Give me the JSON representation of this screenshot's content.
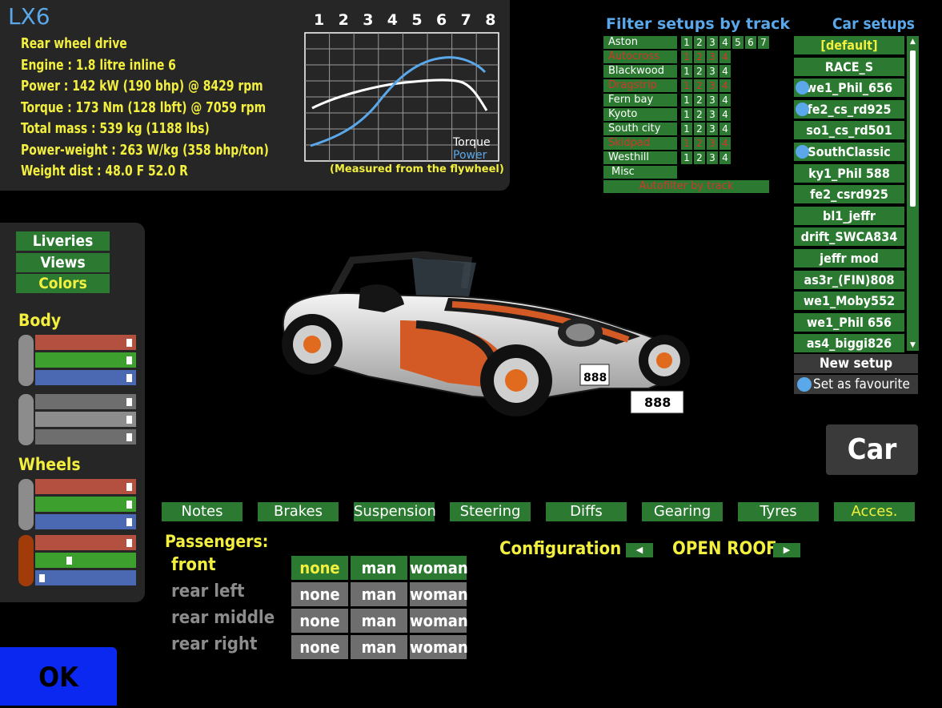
{
  "car": {
    "name": "LX6",
    "specs": [
      "Rear wheel drive",
      "Engine : 1.8 litre inline 6",
      "Power : 142 kW (190 bhp) @ 8429 rpm",
      "Torque : 173 Nm (128 lbft) @ 7059 rpm",
      "Total mass : 539 kg (1188 lbs)",
      "Power-weight : 263 W/kg (358 bhp/ton)",
      "Weight dist : 48.0 F  52.0 R"
    ]
  },
  "graph": {
    "rpm_ticks": [
      "1",
      "2",
      "3",
      "4",
      "5",
      "6",
      "7",
      "8"
    ],
    "legend_torque": "Torque",
    "legend_power": "Power",
    "note": "(Measured from the flywheel)",
    "torque_color": "#ffffff",
    "power_color": "#5aa8ea"
  },
  "filter": {
    "title": "Filter setups by track",
    "tracks": [
      {
        "name": "Aston",
        "nums": [
          "1",
          "2",
          "3",
          "4",
          "5",
          "6",
          "7"
        ],
        "red": false
      },
      {
        "name": "Autocross",
        "nums": [
          "1",
          "2",
          "3",
          "4"
        ],
        "red": true
      },
      {
        "name": "Blackwood",
        "nums": [
          "1",
          "2",
          "3",
          "4"
        ],
        "red": false
      },
      {
        "name": "Dragstrip",
        "nums": [
          "1",
          "2",
          "3",
          "4"
        ],
        "red": true
      },
      {
        "name": "Fern bay",
        "nums": [
          "1",
          "2",
          "3",
          "4"
        ],
        "red": false
      },
      {
        "name": "Kyoto",
        "nums": [
          "1",
          "2",
          "3",
          "4"
        ],
        "red": false
      },
      {
        "name": "South city",
        "nums": [
          "1",
          "2",
          "3",
          "4"
        ],
        "red": false
      },
      {
        "name": "Skidpad",
        "nums": [
          "1",
          "2",
          "3",
          "4"
        ],
        "red": true
      },
      {
        "name": "Westhill",
        "nums": [
          "1",
          "2",
          "3",
          "4"
        ],
        "red": false
      }
    ],
    "misc": "Misc",
    "autofilter": "Autofilter by track"
  },
  "setups": {
    "title": "Car setups",
    "items": [
      {
        "label": "[default]",
        "dot": false,
        "default": true
      },
      {
        "label": "RACE_S",
        "dot": false,
        "default": false
      },
      {
        "label": "we1_Phil_656",
        "dot": true,
        "default": false
      },
      {
        "label": "fe2_cs_rd925",
        "dot": true,
        "default": false
      },
      {
        "label": "so1_cs_rd501",
        "dot": false,
        "default": false
      },
      {
        "label": "SouthClassic",
        "dot": true,
        "default": false
      },
      {
        "label": "ky1_Phil 588",
        "dot": false,
        "default": false
      },
      {
        "label": "fe2_csrd925",
        "dot": false,
        "default": false
      },
      {
        "label": "bl1_jeffr",
        "dot": false,
        "default": false
      },
      {
        "label": "drift_SWCA834",
        "dot": false,
        "default": false
      },
      {
        "label": "jeffr mod",
        "dot": false,
        "default": false
      },
      {
        "label": "as3r_(FIN)808",
        "dot": false,
        "default": false
      },
      {
        "label": "we1_Moby552",
        "dot": false,
        "default": false
      },
      {
        "label": "we1_Phil 656",
        "dot": false,
        "default": false
      },
      {
        "label": "as4_biggi826",
        "dot": false,
        "default": false
      }
    ],
    "new_setup": "New setup",
    "set_favourite": "Set as favourite",
    "car_button": "Car"
  },
  "left_panel": {
    "buttons": [
      "Liveries",
      "Views",
      "Colors"
    ],
    "active_button": "Colors",
    "body_label": "Body",
    "wheels_label": "Wheels",
    "body_group1": {
      "swatch": "#8c8c8c",
      "sliders": [
        {
          "color": "#b3503f",
          "level": 0.96
        },
        {
          "color": "#3da02e",
          "level": 0.96
        },
        {
          "color": "#4b68b2",
          "level": 0.96
        }
      ]
    },
    "body_group2": {
      "swatch": "#8c8c8c",
      "sliders": [
        {
          "color": "#6e6e6e",
          "level": 0.96
        },
        {
          "color": "#8c8c8c",
          "level": 0.96
        },
        {
          "color": "#6e6e6e",
          "level": 0.96
        }
      ]
    },
    "wheels_group1": {
      "swatch": "#8c8c8c",
      "sliders": [
        {
          "color": "#b3503f",
          "level": 0.96
        },
        {
          "color": "#3da02e",
          "level": 0.96
        },
        {
          "color": "#4b68b2",
          "level": 0.96
        }
      ]
    },
    "wheels_group2": {
      "swatch": "#a13c0a",
      "sliders": [
        {
          "color": "#b3503f",
          "level": 0.96
        },
        {
          "color": "#3da02e",
          "level": 0.33
        },
        {
          "color": "#4b68b2",
          "level": 0.04
        }
      ]
    }
  },
  "tabs": {
    "items": [
      "Notes",
      "Brakes",
      "Suspension",
      "Steering",
      "Diffs",
      "Gearing",
      "Tyres",
      "Acces."
    ],
    "active": "Acces."
  },
  "passengers": {
    "title": "Passengers:",
    "rows": [
      {
        "label": "front",
        "selected": "none",
        "enabled": true
      },
      {
        "label": "rear left",
        "selected": "",
        "enabled": false
      },
      {
        "label": "rear middle",
        "selected": "",
        "enabled": false
      },
      {
        "label": "rear right",
        "selected": "",
        "enabled": false
      }
    ],
    "options": [
      "none",
      "man",
      "woman"
    ]
  },
  "configuration": {
    "label": "Configuration",
    "value": "OPEN ROOF"
  },
  "ok_button": "OK",
  "car_livery": {
    "plate": "888",
    "side_number": "888"
  }
}
